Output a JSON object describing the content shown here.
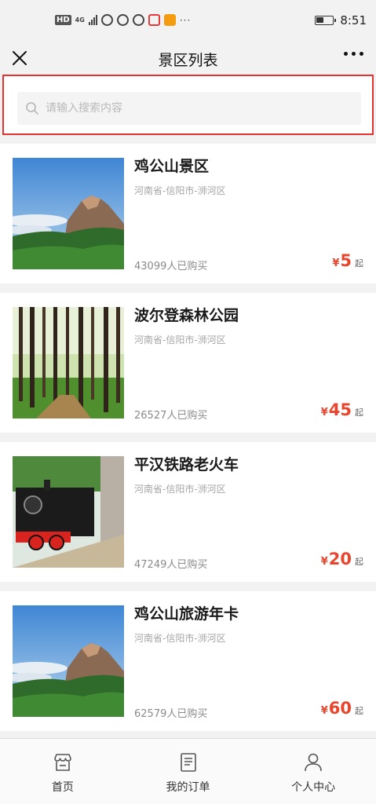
{
  "status_bar": {
    "hd_badge": "HD",
    "network": "4G",
    "overflow": "···",
    "time": "8:51"
  },
  "nav": {
    "title": "景区列表",
    "close_icon": "close-icon",
    "more_icon": "more-dots-icon"
  },
  "search": {
    "placeholder": "请输入搜索内容",
    "value": "",
    "icon": "search-icon",
    "highlight_color": "#e4322e"
  },
  "spots": [
    {
      "name": "鸡公山景区",
      "location": "河南省-信阳市-浉河区",
      "sold": "43099人已购买",
      "currency": "¥",
      "price": "5",
      "unit": "起"
    },
    {
      "name": "波尔登森林公园",
      "location": "河南省-信阳市-浉河区",
      "sold": "26527人已购买",
      "currency": "¥",
      "price": "45",
      "unit": "起"
    },
    {
      "name": "平汉铁路老火车",
      "location": "河南省-信阳市-浉河区",
      "sold": "47249人已购买",
      "currency": "¥",
      "price": "20",
      "unit": "起"
    },
    {
      "name": "鸡公山旅游年卡",
      "location": "河南省-信阳市-浉河区",
      "sold": "62579人已购买",
      "currency": "¥",
      "price": "60",
      "unit": "起"
    }
  ],
  "tabbar": {
    "items": [
      {
        "label": "首页",
        "icon": "shop-icon"
      },
      {
        "label": "我的订单",
        "icon": "order-list-icon"
      },
      {
        "label": "个人中心",
        "icon": "user-icon"
      }
    ]
  },
  "colors": {
    "price": "#e8452c",
    "background": "#f2f2f2",
    "card": "#ffffff"
  }
}
